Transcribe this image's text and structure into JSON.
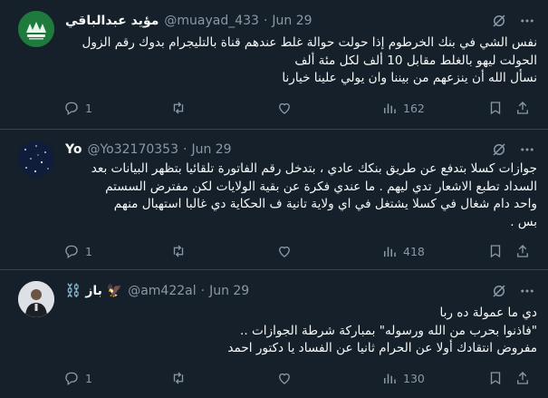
{
  "tweets": [
    {
      "name": "مؤيد عبدالباقي",
      "handle": "@muayad_433",
      "date": "Jun 29",
      "lines": [
        "نفس الشي في بنك الخرطوم إذا حولت حوالة غلط عندهم قناة بالتليجرام بدوك رقم الزول",
        "الحولت ليهو بالغلط مقابل 10 ألف لكل مئة ألف",
        "نسأل الله أن ينزعهم من بيننا وان يولي علينا خيارنا"
      ],
      "replies": "1",
      "retweets": "",
      "likes": "",
      "views": "162",
      "avatar_label": "مؤيد"
    },
    {
      "name": "Yo",
      "handle": "@Yo32170353",
      "date": "Jun 29",
      "lines": [
        "جوازات كسلا بتدفع عن طريق بنكك عادي ، بتدخل رقم الفاتورة تلقائيا بتظهر البيانات بعد",
        "السداد تطبع الاشعار تدي ليهم . ما عندي فكرة عن بقية الولايات لكن مفترض السستم",
        "واحد دام شغال في كسلا يشتغل في اي ولاية تانية ف الحكاية دي غالبا استهبال منهم",
        "بس ."
      ],
      "replies": "1",
      "retweets": "",
      "likes": "",
      "views": "418"
    },
    {
      "name": "⛓️ باز 🦅",
      "handle": "@am422al",
      "date": "Jun 29",
      "lines": [
        "دي ما عمولة ده ربا",
        "\"فاذنوا بحرب من الله ورسوله\" بمباركة شرطة الجوازات ..",
        "مفروض انتقادك أولا عن الحرام ثانيا عن الفساد يا دكتور احمد"
      ],
      "replies": "1",
      "retweets": "",
      "likes": "",
      "views": "130"
    }
  ],
  "colors": {
    "background": "#15202b",
    "border": "#38444d",
    "text": "#f7f9f9",
    "muted": "#8b98a5"
  },
  "icons": [
    "reply-icon",
    "retweet-icon",
    "like-icon",
    "views-icon",
    "bookmark-icon",
    "share-icon",
    "grok-icon",
    "more-icon"
  ]
}
